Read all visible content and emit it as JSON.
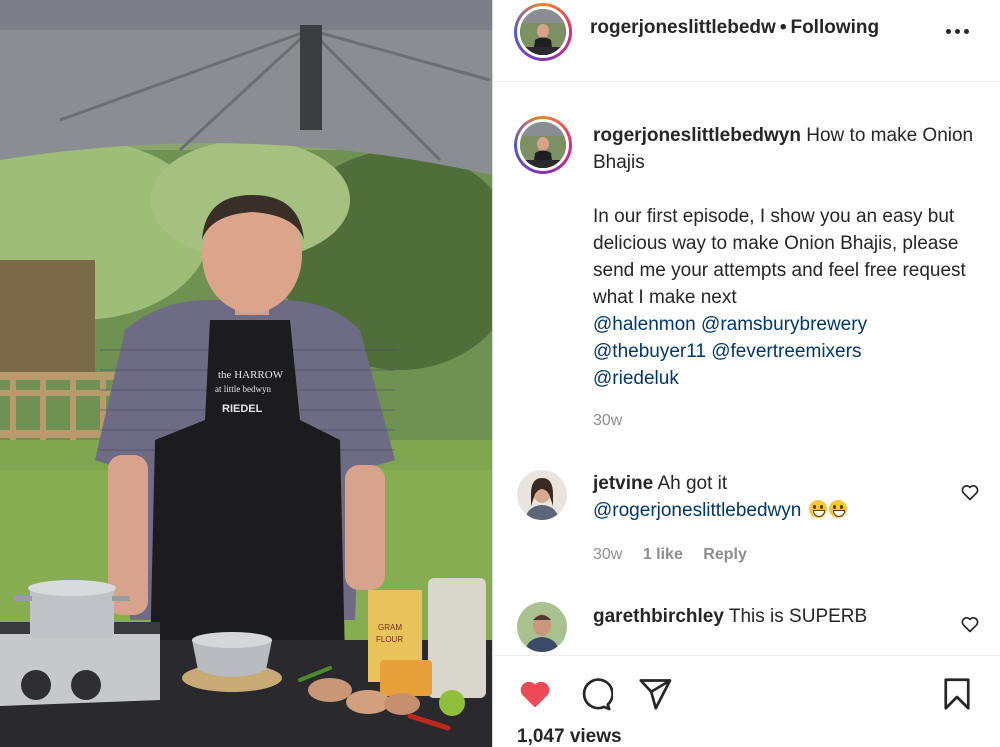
{
  "post": {
    "username": "rogerjoneslittlebedwyn",
    "header_username": "rogerjoneslittlebedw",
    "separator": "•",
    "following_label": "Following",
    "caption_title": "How to make Onion Bhajis",
    "caption_body": "In our first episode, I show you an easy but delicious way to make Onion Bhajis, please send me your attempts and feel free request what I make next",
    "mentions_line1": [
      "@halenmon",
      "@ramsburybrewery"
    ],
    "mentions_line2": [
      "@thebuyer11",
      "@fevertreemixers"
    ],
    "mentions_line3": [
      "@riedeluk"
    ],
    "time": "30w",
    "views": "1,047 views"
  },
  "comments": [
    {
      "username": "jetvine",
      "text": "Ah got it",
      "mention": "@rogerjoneslittlebedwyn",
      "emoji_count": 2,
      "time": "30w",
      "likes": "1 like",
      "reply_label": "Reply"
    },
    {
      "username": "garethbirchley",
      "text": "This is SUPERB"
    }
  ],
  "photo_labels": {
    "apron_top": "the HARROW",
    "apron_bottom": "at little bedwyn",
    "apron_brand": "RIEDEL",
    "flour_top": "GRAM",
    "flour_bottom": "FLOUR"
  },
  "icons": {
    "like": "heart-icon",
    "comment": "comment-icon",
    "share": "paper-plane-icon",
    "save": "bookmark-icon",
    "more": "ellipsis-icon"
  },
  "colors": {
    "liked_heart": "#ed4956",
    "mention": "#00376b",
    "meta_text": "#8e8e8e"
  }
}
